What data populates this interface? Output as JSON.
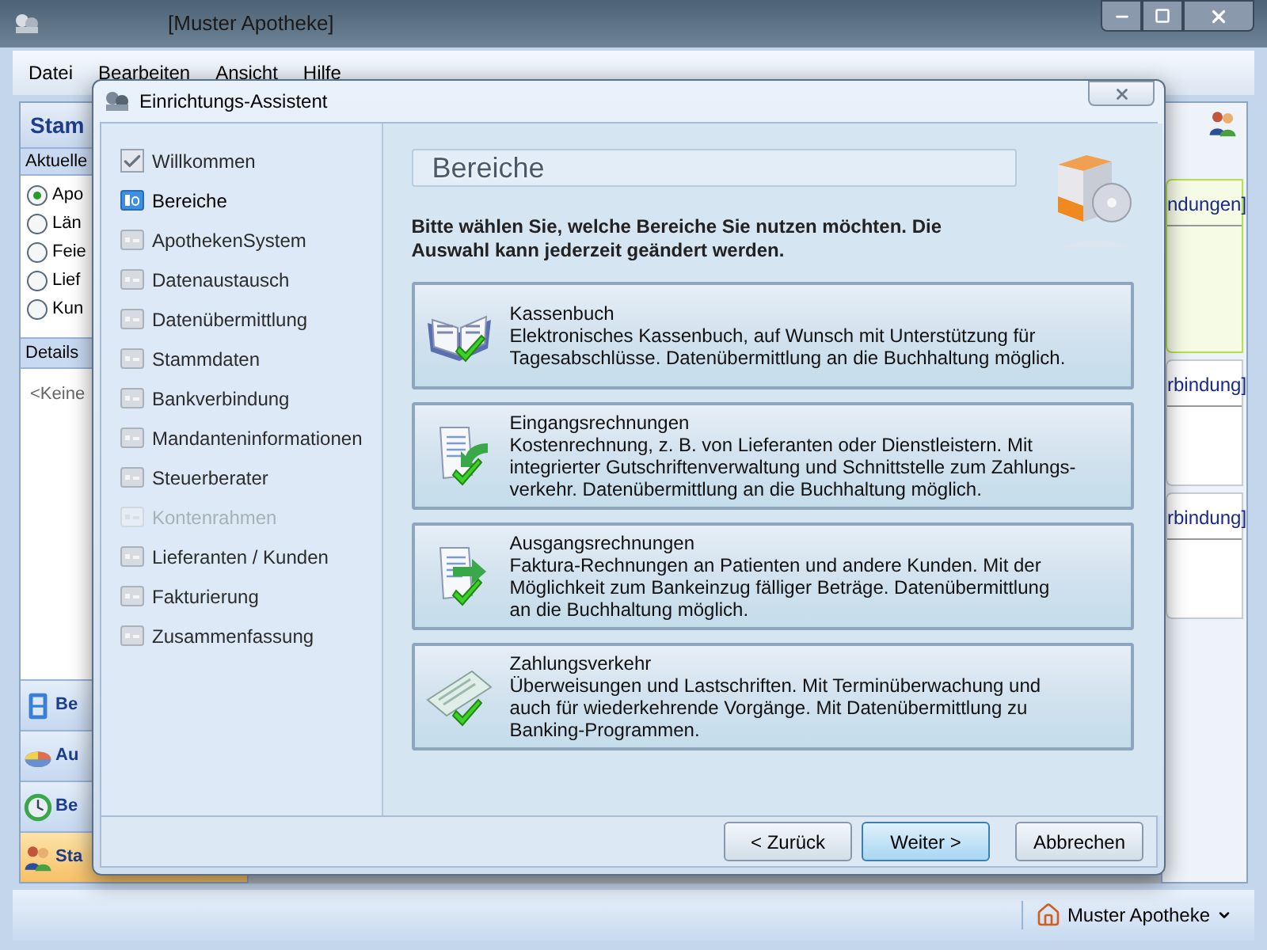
{
  "window": {
    "title": "[Muster Apotheke]"
  },
  "menu": [
    "Datei",
    "Bearbeiten",
    "Ansicht",
    "Hilfe"
  ],
  "left_panel": {
    "header": "Stam",
    "section": "Aktuelle",
    "options": [
      {
        "label": "Apo",
        "selected": true
      },
      {
        "label": "Län",
        "selected": false
      },
      {
        "label": "Feie",
        "selected": false
      },
      {
        "label": "Lief",
        "selected": false
      },
      {
        "label": "Kun",
        "selected": false
      }
    ],
    "details_header": "Details",
    "details_text": "<Keine",
    "nav": [
      {
        "label": "Be",
        "selected": false
      },
      {
        "label": "Au",
        "selected": false
      },
      {
        "label": "Be",
        "selected": false
      },
      {
        "label": "Sta",
        "selected": true
      }
    ]
  },
  "right_panel": {
    "links": [
      "ndungen]",
      "rbindung]",
      "rbindung]"
    ]
  },
  "status_bar": {
    "profile": "Muster Apotheke"
  },
  "dialog": {
    "title": "Einrichtungs-Assistent",
    "steps": [
      {
        "label": "Willkommen",
        "done": true,
        "selected": false,
        "disabled": false
      },
      {
        "label": "Bereiche",
        "done": false,
        "selected": true,
        "disabled": false
      },
      {
        "label": "ApothekenSystem",
        "done": false,
        "selected": false,
        "disabled": false
      },
      {
        "label": "Datenaustausch",
        "done": false,
        "selected": false,
        "disabled": false
      },
      {
        "label": "Datenübermittlung",
        "done": false,
        "selected": false,
        "disabled": false
      },
      {
        "label": "Stammdaten",
        "done": false,
        "selected": false,
        "disabled": false
      },
      {
        "label": "Bankverbindung",
        "done": false,
        "selected": false,
        "disabled": false
      },
      {
        "label": "Mandanteninformationen",
        "done": false,
        "selected": false,
        "disabled": false
      },
      {
        "label": "Steuerberater",
        "done": false,
        "selected": false,
        "disabled": false
      },
      {
        "label": "Kontenrahmen",
        "done": false,
        "selected": false,
        "disabled": true
      },
      {
        "label": "Lieferanten / Kunden",
        "done": false,
        "selected": false,
        "disabled": false
      },
      {
        "label": "Fakturierung",
        "done": false,
        "selected": false,
        "disabled": false
      },
      {
        "label": "Zusammenfassung",
        "done": false,
        "selected": false,
        "disabled": false
      }
    ],
    "heading": "Bereiche",
    "intro": "Bitte wählen Sie, welche Bereiche Sie nutzen möchten. Die Auswahl kann jederzeit geändert werden.",
    "areas": [
      {
        "title": "Kassenbuch",
        "lines": [
          "Elektronisches Kassenbuch, auf Wunsch mit Unterstützung für",
          "Tagesabschlüsse. Datenübermittlung an die Buchhaltung möglich."
        ]
      },
      {
        "title": "Eingangsrechnungen",
        "lines": [
          "Kostenrechnung, z. B. von Lieferanten oder Dienstleistern. Mit",
          "integrierter Gutschriftenverwaltung und Schnittstelle zum Zahlungs-",
          "verkehr. Datenübermittlung an die Buchhaltung möglich."
        ]
      },
      {
        "title": "Ausgangsrechnungen",
        "lines": [
          "Faktura-Rechnungen an Patienten und andere Kunden. Mit der",
          "Möglichkeit zum Bankeinzug fälliger Beträge. Datenübermittlung",
          "an die Buchhaltung möglich."
        ]
      },
      {
        "title": "Zahlungsverkehr",
        "lines": [
          "Überweisungen und Lastschriften. Mit Terminüberwachung und",
          "auch für wiederkehrende Vorgänge. Mit Datenübermittlung zu",
          "Banking-Programmen."
        ]
      }
    ],
    "buttons": [
      {
        "label": "< Zurück",
        "selected": false
      },
      {
        "label": "Weiter >",
        "selected": true
      },
      {
        "label": "Abbrechen",
        "selected": false
      }
    ]
  }
}
